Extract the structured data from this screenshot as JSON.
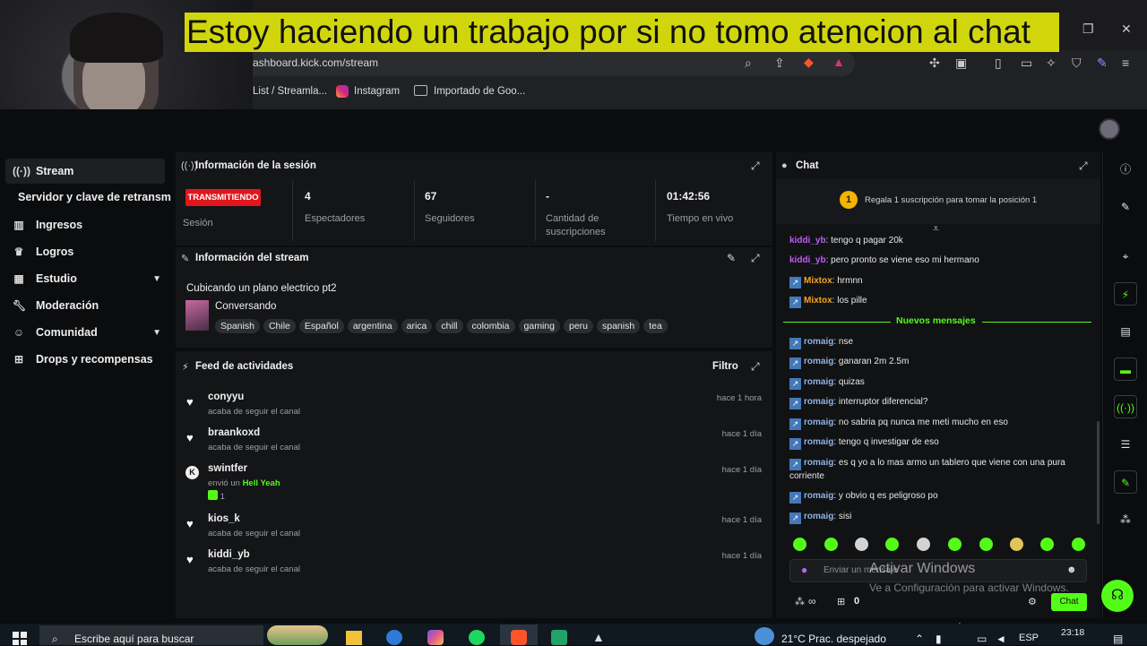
{
  "caption": "Estoy haciendo un trabajo por si no tomo atencion al chat",
  "browser": {
    "url": "ashboard.kick.com/stream",
    "bookmarks": [
      "List / Streamla...",
      "Instagram",
      "Importado de Goo..."
    ]
  },
  "sidebar": {
    "items": [
      {
        "label": "Stream",
        "icon": "signal-icon"
      },
      {
        "label": "Servidor y clave de retransm",
        "icon": ""
      },
      {
        "label": "Ingresos",
        "icon": "chart-icon"
      },
      {
        "label": "Logros",
        "icon": "trophy-icon"
      },
      {
        "label": "Estudio",
        "icon": "studio-icon"
      },
      {
        "label": "Moderación",
        "icon": "wrench-icon"
      },
      {
        "label": "Comunidad",
        "icon": "people-icon"
      },
      {
        "label": "Drops y recompensas",
        "icon": "gift-icon"
      }
    ]
  },
  "session": {
    "title": "Información de la sesión",
    "status_badge": "TRANSMITIENDO",
    "status_label": "Sesión",
    "stats": [
      {
        "value": "4",
        "label": "Espectadores"
      },
      {
        "value": "67",
        "label": "Seguidores"
      },
      {
        "value": "-",
        "label": "Cantidad de suscripciones"
      },
      {
        "value": "01:42:56",
        "label": "Tiempo en vivo"
      }
    ]
  },
  "stream_info": {
    "title": "Información del stream",
    "stream_title": "Cubicando un plano electrico pt2",
    "category": "Conversando",
    "tags": [
      "Spanish",
      "Chile",
      "Español",
      "argentina",
      "arica",
      "chill",
      "colombia",
      "gaming",
      "peru",
      "spanish",
      "tea"
    ]
  },
  "feed": {
    "title": "Feed de actividades",
    "filter_label": "Filtro",
    "items": [
      {
        "name": "conyyu",
        "sub": "acaba de seguir el canal",
        "time": "hace 1 hora",
        "type": "follow"
      },
      {
        "name": "braankoxd",
        "sub": "acaba de seguir el canal",
        "time": "hace 1 día",
        "type": "follow"
      },
      {
        "name": "swintfer",
        "sub": "envió un",
        "sub_highlight": "Hell Yeah",
        "count": "1",
        "time": "hace 1 día",
        "type": "kick"
      },
      {
        "name": "kios_k",
        "sub": "acaba de seguir el canal",
        "time": "hace 1 día",
        "type": "follow"
      },
      {
        "name": "kiddi_yb",
        "sub": "acaba de seguir el canal",
        "time": "hace 1 día",
        "type": "follow"
      }
    ]
  },
  "chat": {
    "title": "Chat",
    "pinned": "Regala 1 suscripción para tomar la posición 1",
    "pinned_rank": "1",
    "new_messages_label": "Nuevos mensajes",
    "messages_before": [
      {
        "user": "kiddi_yb",
        "text": ": tengo q pagar 20k",
        "color": "#c15cf2",
        "badge": false
      },
      {
        "user": "kiddi_yb",
        "text": ": pero pronto se viene eso mi hermano",
        "color": "#c15cf2",
        "badge": false
      },
      {
        "user": "Mixtox",
        "text": ": hrmnn",
        "color": "#f5a623",
        "badge": true
      },
      {
        "user": "Mixtox",
        "text": ": los pille",
        "color": "#f5a623",
        "badge": true
      }
    ],
    "messages_after": [
      {
        "user": "romaig",
        "text": ": nse"
      },
      {
        "user": "romaig",
        "text": ": ganaran 2m 2.5m"
      },
      {
        "user": "romaig",
        "text": ": quizas"
      },
      {
        "user": "romaig",
        "text": ": interruptor diferencial?"
      },
      {
        "user": "romaig",
        "text": ": no sabria pq nunca me meti mucho en eso"
      },
      {
        "user": "romaig",
        "text": ": tengo q investigar de eso"
      },
      {
        "user": "romaig",
        "text": ": es q yo a lo mas armo un tablero que viene con una pura corriente"
      },
      {
        "user": "romaig",
        "text": ": y obvio q es peligroso po"
      },
      {
        "user": "romaig",
        "text": ": sisi"
      }
    ],
    "user_color": "#8fb3e6",
    "input_placeholder": "Enviar un mensaje",
    "points_value": "∞",
    "gift_count": "0",
    "send_label": "Chat"
  },
  "watermark": {
    "line1": "Activar Windows",
    "line2": "Ve a Configuración para activar Windows."
  },
  "taskbar": {
    "search_placeholder": "Escribe aquí para buscar",
    "weather": "21°C  Prac. despejado",
    "lang": "ESP",
    "time": "23:18"
  },
  "accent_color": "#53fc18",
  "live_color": "#e1171d"
}
